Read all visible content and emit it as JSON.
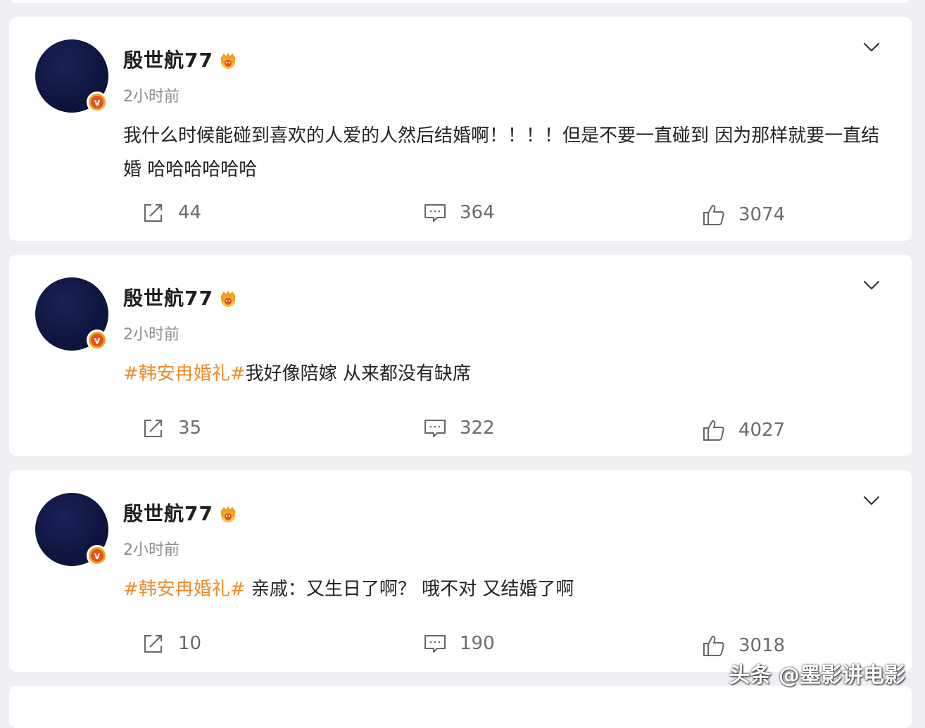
{
  "colors": {
    "background": "#eef0f4",
    "card": "#ffffff",
    "hashtag": "#f08a2b",
    "avatar": "#0e1640",
    "verified_badge": "#e8511c"
  },
  "posts": [
    {
      "username": "殷世航77",
      "time": "2小时前",
      "hashtag": "",
      "text": "我什么时候能碰到喜欢的人爱的人然后结婚啊！！！！但是不要一直碰到 因为那样就要一直结婚 哈哈哈哈哈哈",
      "reposts": "44",
      "comments": "364",
      "likes": "3074",
      "icons": [
        "avatar",
        "verified-badge-icon",
        "crown-icon",
        "chevron-down-icon",
        "repost-icon",
        "comment-icon",
        "like-icon"
      ]
    },
    {
      "username": "殷世航77",
      "time": "2小时前",
      "hashtag": "#韩安冉婚礼#",
      "text": "我好像陪嫁 从来都没有缺席",
      "reposts": "35",
      "comments": "322",
      "likes": "4027"
    },
    {
      "username": "殷世航77",
      "time": "2小时前",
      "hashtag": "#韩安冉婚礼#",
      "text": " 亲戚：又生日了啊？ 哦不对 又结婚了啊",
      "reposts": "10",
      "comments": "190",
      "likes": "3018"
    }
  ],
  "watermark": "头条 @墨影讲电影"
}
